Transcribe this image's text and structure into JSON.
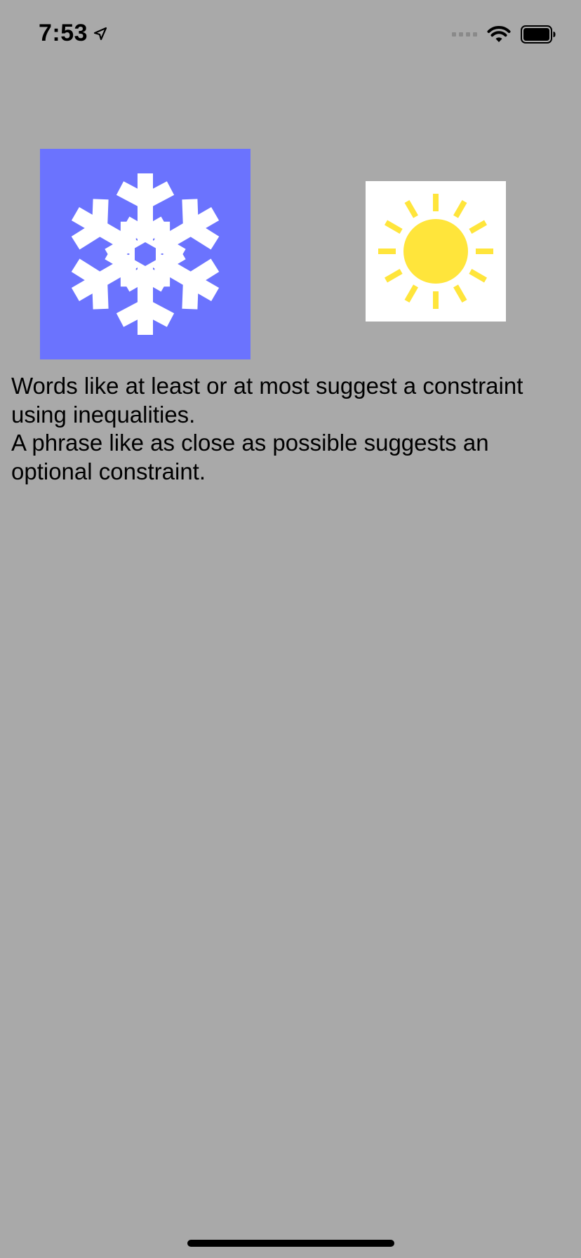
{
  "status_bar": {
    "time": "7:53",
    "icons": [
      "location-arrow-icon",
      "signal-icon",
      "wifi-icon",
      "battery-icon"
    ]
  },
  "images": {
    "snow": {
      "icon": "snowflake-icon",
      "background": "#6b73fe",
      "color": "#ffffff"
    },
    "sun": {
      "icon": "sun-icon",
      "background": "#ffffff",
      "color": "#ffe53b"
    }
  },
  "description": {
    "line1": "Words like at least or at most suggest a constraint using inequalities.",
    "line2": "A phrase like as close as possible suggests an optional constraint."
  },
  "colors": {
    "background": "#a9a9a9"
  }
}
